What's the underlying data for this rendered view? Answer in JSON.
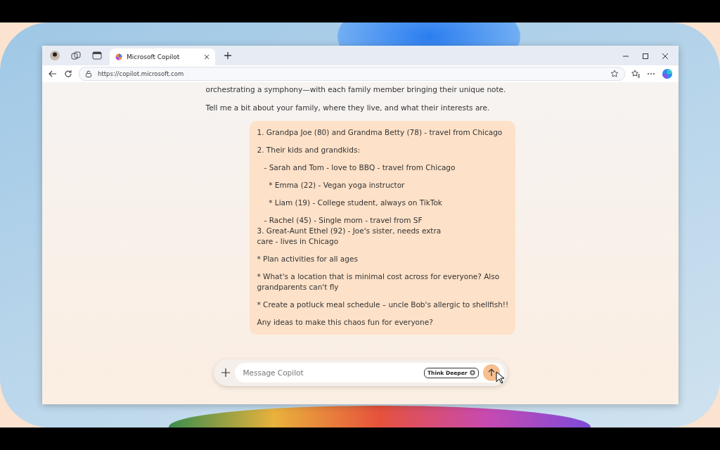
{
  "browser": {
    "tabs": [
      {
        "title": "Microsoft Copilot",
        "selected": true
      }
    ],
    "address": "https://copilot.microsoft.com"
  },
  "chat": {
    "assistant_lines": [
      "orchestrating a symphony—with each family member bringing their unique note.",
      "Tell me a bit about your family, where they live, and what their interests are."
    ],
    "user_message": [
      [
        "1. Grandpa Joe (80) and Grandma Betty (78) - travel from Chicago"
      ],
      [
        "2. Their kids and grandkids:"
      ],
      [
        "   - Sarah and Tom - love to BBQ - travel from Chicago"
      ],
      [
        "     * Emma (22) - Vegan yoga instructor"
      ],
      [
        "     * Liam (19) - College student, always on TikTok"
      ],
      [
        "   - Rachel (45) - Single mom - travel from SF",
        "3. Great-Aunt Ethel (92) - Joe's sister, needs extra",
        "care - lives in Chicago"
      ],
      [
        "* Plan activities for all ages"
      ],
      [
        "* What's a location that is minimal cost across for everyone? Also",
        "grandparents can't fly"
      ],
      [
        "* Create a potluck meal schedule – uncle Bob's allergic to shellfish!!"
      ],
      [
        "Any ideas to make this chaos fun for everyone?"
      ]
    ]
  },
  "composer": {
    "placeholder": "Message Copilot",
    "think_deeper": "Think Deeper"
  }
}
